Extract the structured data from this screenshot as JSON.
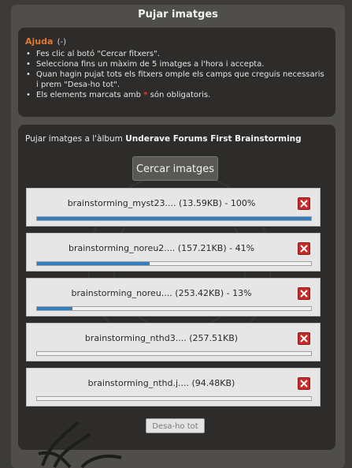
{
  "dialog": {
    "title": "Pujar imatges"
  },
  "help": {
    "title": "Ajuda",
    "toggle": "(-)",
    "bullet": "•",
    "items": [
      "Fes clic al botó \"Cercar fitxers\".",
      "Selecciona fins un màxim de 5 imatges a l'hora i accepta.",
      "Quan hagin pujat tots els fitxers omple els camps que creguis necessaris i prem \"Desa-ho tot\"."
    ],
    "required_note": {
      "before": "Els elements marcats amb",
      "star": "*",
      "after": "són obligatoris."
    }
  },
  "upload": {
    "album_prefix": "Pujar imatges a l'àlbum",
    "album_name": "Underave Forums First Brainstorming",
    "search_button": "Cercar imatges",
    "files": [
      {
        "label": "brainstorming_myst23.... (13.59KB) - 100%",
        "progress": 1.0
      },
      {
        "label": "brainstorming_noreu2.... (157.21KB) - 41%",
        "progress": 0.41
      },
      {
        "label": "brainstorming_noreu.... (253.42KB) - 13%",
        "progress": 0.13
      },
      {
        "label": "brainstorming_nthd3.... (257.51KB)",
        "progress": 0
      },
      {
        "label": "brainstorming_nthd.j.... (94.48KB)",
        "progress": 0
      }
    ],
    "save_all_button": "Desa-ho tot"
  },
  "colors": {
    "accent": "#e2782f",
    "progress": "#2f7fc1",
    "remove": "#c72a2a",
    "required": "#e03a2a"
  },
  "icons": {
    "remove": "close-icon"
  }
}
